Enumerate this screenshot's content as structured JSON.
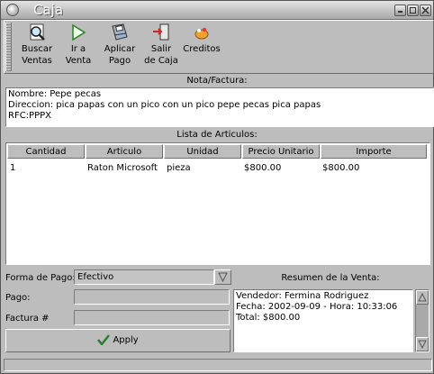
{
  "window": {
    "title": "Caja"
  },
  "toolbar": {
    "buttons": [
      {
        "line1": "Buscar",
        "line2": "Ventas",
        "icon": "magnifier-icon"
      },
      {
        "line1": "Ir a",
        "line2": "Venta",
        "icon": "play-arrow-icon"
      },
      {
        "line1": "Aplicar",
        "line2": "Pago",
        "icon": "floppy-disk-icon"
      },
      {
        "line1": "Salir",
        "line2": "de Caja",
        "icon": "exit-door-icon"
      },
      {
        "line1": "Creditos",
        "line2": "",
        "icon": "credits-icon"
      }
    ]
  },
  "nota": {
    "label": "Nota/Factura:",
    "lines": [
      "Nombre: Pepe pecas",
      "Direccion: pica papas con un pico con un pico pepe pecas pica papas",
      "RFC:PPPX"
    ]
  },
  "articulos": {
    "label": "Lista de Articulos:",
    "columns": [
      "Cantidad",
      "Articulo",
      "Unidad",
      "Precio Unitario",
      "Importe"
    ],
    "rows": [
      [
        "1",
        "Raton Microsoft",
        "pieza",
        "$800.00",
        "$800.00"
      ]
    ]
  },
  "form": {
    "forma_pago_label": "Forma de Pago:",
    "forma_pago_value": "Efectivo",
    "pago_label": "Pago:",
    "pago_value": "",
    "factura_label": "Factura #",
    "factura_value": "",
    "apply_label": "Apply"
  },
  "resumen": {
    "label": "Resumen de la Venta:",
    "lines": [
      "Vendedor: Fermina Rodriguez",
      "Fecha: 2002-09-09 - Hora: 10:33:06",
      "Total: $800.00"
    ]
  },
  "colors": {
    "window_bg": "#bdbdbd",
    "title_text": "#ffffff",
    "checkmark": "#2e7d32"
  }
}
